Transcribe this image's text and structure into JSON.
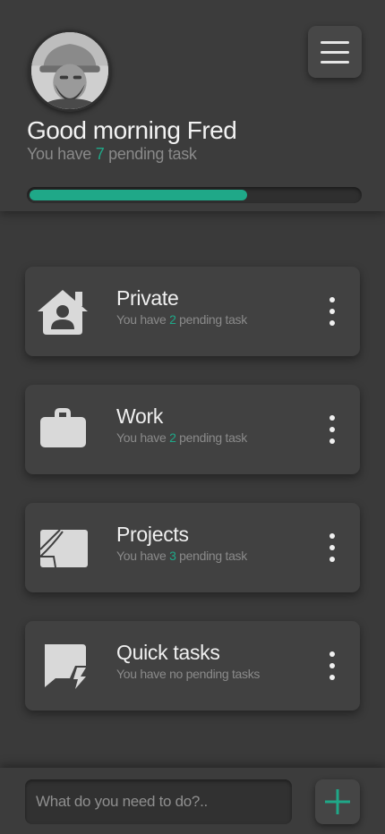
{
  "header": {
    "greeting": "Good morning Fred",
    "subline_prefix": "You have ",
    "pending_count": "7",
    "subline_suffix": " pending task",
    "progress_fraction": 0.66
  },
  "categories": [
    {
      "title": "Private",
      "sub_prefix": "You have ",
      "count": "2",
      "sub_suffix": " pending task",
      "icon": "house-person-icon"
    },
    {
      "title": "Work",
      "sub_prefix": "You have ",
      "count": "2",
      "sub_suffix": " pending task",
      "icon": "briefcase-icon"
    },
    {
      "title": "Projects",
      "sub_prefix": "You have ",
      "count": "3",
      "sub_suffix": " pending task",
      "icon": "folder-page-icon"
    },
    {
      "title": "Quick tasks",
      "sub_text": "You have no pending tasks",
      "icon": "chat-bolt-icon"
    }
  ],
  "footer": {
    "input_placeholder": "What do you need to do?.."
  },
  "colors": {
    "accent": "#1fa888",
    "background": "#3a3a3a",
    "card": "#414141"
  }
}
